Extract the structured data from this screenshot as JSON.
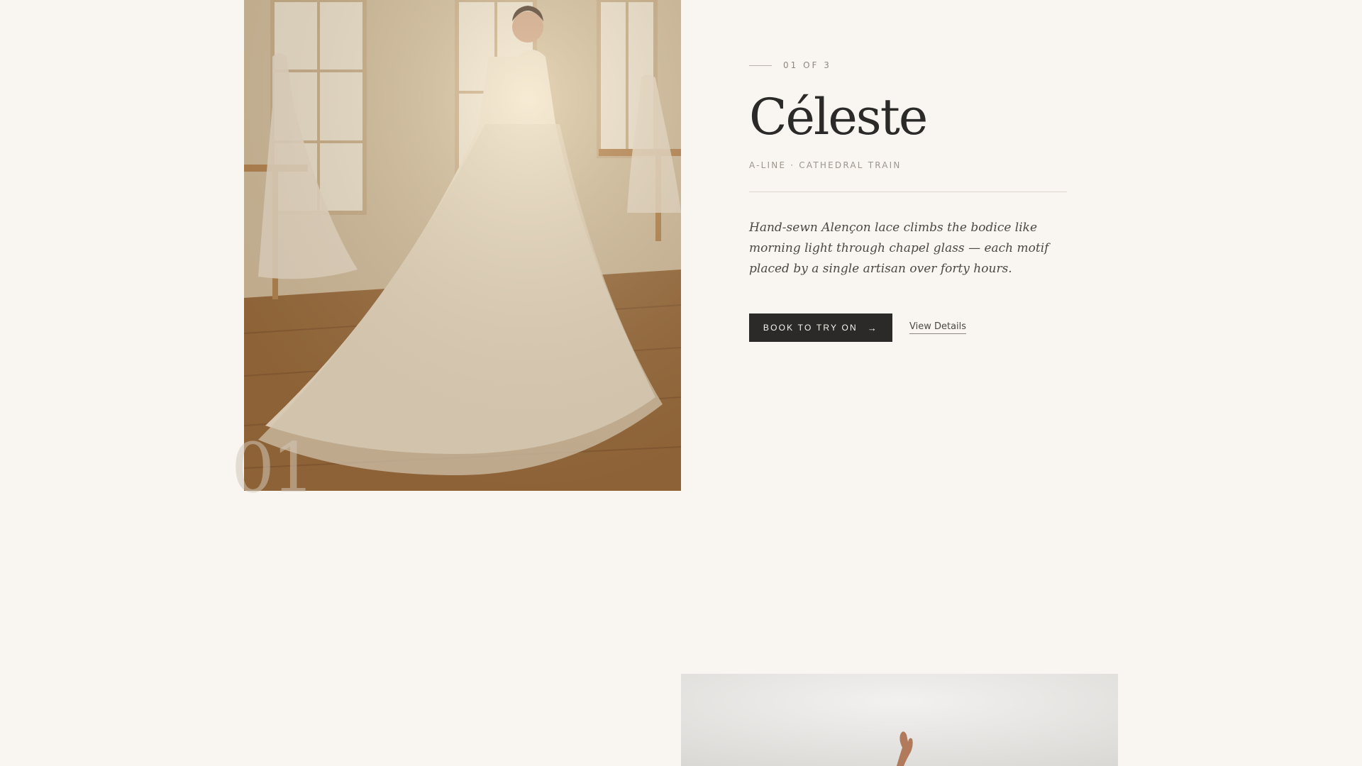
{
  "looks": [
    {
      "counter": "01 OF 3",
      "index": "01",
      "name": "Céleste",
      "meta": "A-LINE · CATHEDRAL TRAIN",
      "description": "Hand-sewn Alençon lace climbs the bodice like morning light through chapel glass — each motif placed by a single artisan over forty hours.",
      "primary_cta": "BOOK TO TRY ON",
      "primary_cta_icon": "arrow-right-icon",
      "secondary_cta": "View Details"
    }
  ],
  "colors": {
    "background": "#f9f6f1",
    "ink": "#2b2a28",
    "muted": "#9b958d"
  }
}
